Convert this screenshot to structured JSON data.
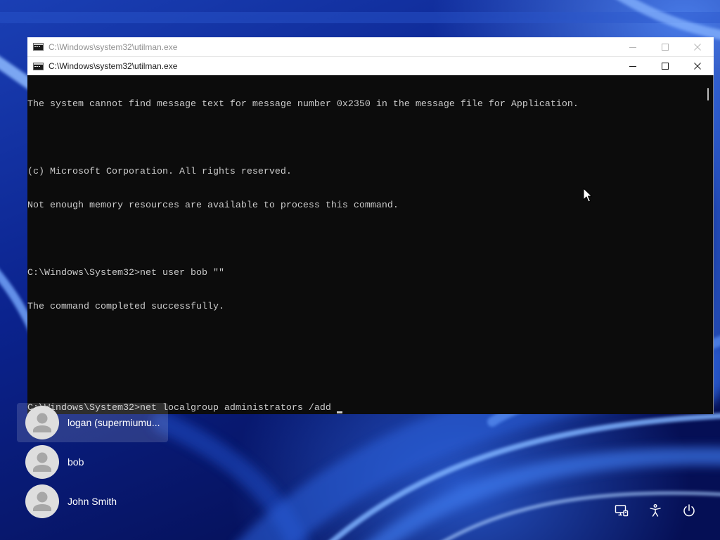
{
  "windows": [
    {
      "title": "C:\\Windows\\system32\\utilman.exe",
      "active": false,
      "icon": "cmd-icon",
      "controls": [
        "minimize-icon",
        "maximize-icon",
        "close-icon"
      ]
    },
    {
      "title": "C:\\Windows\\system32\\utilman.exe",
      "active": true,
      "icon": "cmd-icon",
      "controls": [
        "minimize-icon",
        "maximize-icon",
        "close-icon"
      ]
    }
  ],
  "console": {
    "lines": [
      "The system cannot find message text for message number 0x2350 in the message file for Application.",
      "",
      "(c) Microsoft Corporation. All rights reserved.",
      "Not enough memory resources are available to process this command.",
      "",
      "C:\\Windows\\System32>net user bob \"\"",
      "The command completed successfully.",
      "",
      "",
      "C:\\Windows\\System32>net localgroup administrators /add "
    ]
  },
  "users": [
    {
      "name": "logan (supermiumu...",
      "selected": true,
      "icon": "user-avatar-icon"
    },
    {
      "name": "bob",
      "selected": false,
      "icon": "user-avatar-icon"
    },
    {
      "name": "John Smith",
      "selected": false,
      "icon": "user-avatar-icon"
    }
  ],
  "system_buttons": [
    {
      "icon": "network-icon"
    },
    {
      "icon": "accessibility-icon"
    },
    {
      "icon": "power-icon"
    }
  ],
  "pointer": {
    "icon": "arrow-pointer-icon"
  },
  "colors": {
    "console_background": "#0c0c0c",
    "console_text": "#cccccc",
    "titlebar_background": "#ffffff",
    "wallpaper_base": "#0a1f86",
    "selected_tile": "rgba(255,255,255,0.14)"
  }
}
